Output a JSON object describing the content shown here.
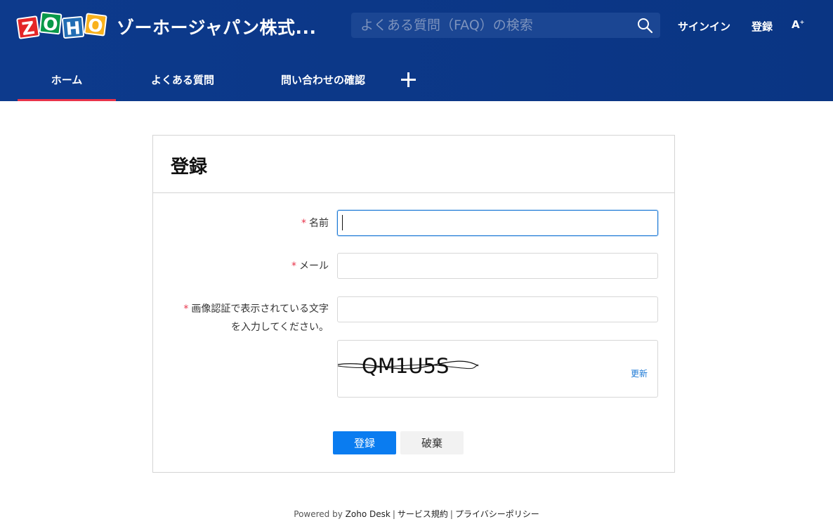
{
  "header": {
    "logo_letters": [
      "Z",
      "O",
      "H",
      "O"
    ],
    "logo_colors": [
      "#e42527",
      "#089949",
      "#226db4",
      "#f9b21d"
    ],
    "brand_title": "ゾーホージャパン株式...",
    "search_placeholder": "よくある質問（FAQ）の検索",
    "signin_label": "サインイン",
    "signup_label": "登録",
    "font_size_label": "A"
  },
  "nav": {
    "tabs": [
      {
        "label": "ホーム",
        "active": true
      },
      {
        "label": "よくある質問",
        "active": false
      },
      {
        "label": "問い合わせの確認",
        "active": false
      }
    ]
  },
  "form": {
    "title": "登録",
    "required_mark": "*",
    "name_label": "名前",
    "email_label": "メール",
    "captcha_label_line1": "画像認証で表示されている文字",
    "captcha_label_line2": "を入力してください。",
    "name_value": "",
    "email_value": "",
    "captcha_value": "",
    "captcha_text": "QM1U5S",
    "refresh_label": "更新",
    "submit_label": "登録",
    "discard_label": "破棄"
  },
  "footer": {
    "powered_by": "Powered by",
    "zoho_desk": "Zoho Desk",
    "separator": "|",
    "terms": "サービス規約",
    "privacy": "プライバシーポリシー"
  },
  "colors": {
    "header_bg": "#0a3583",
    "active_tab_underline": "#e8334a",
    "primary_button": "#0a7cf0",
    "link": "#1e7ad6",
    "required": "#e8334a"
  }
}
